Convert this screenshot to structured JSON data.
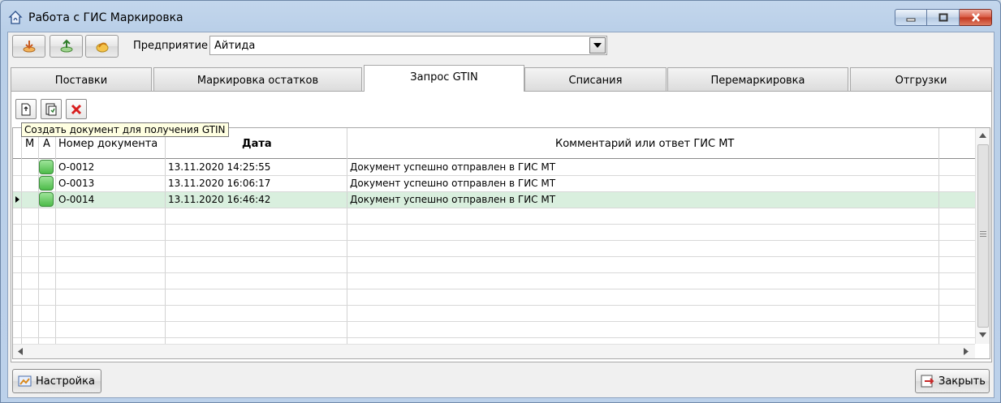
{
  "window": {
    "title": "Работа с ГИС Маркировка"
  },
  "toolbar": {
    "enterprise_label": "Предприятие",
    "enterprise_value": "Айтида"
  },
  "tabs": [
    {
      "label": "Поставки"
    },
    {
      "label": "Маркировка остатков"
    },
    {
      "label": "Запрос GTIN"
    },
    {
      "label": "Списания"
    },
    {
      "label": "Перемаркировка"
    },
    {
      "label": "Отгрузки"
    }
  ],
  "tooltip": "Создать документ для получения GTIN",
  "grid": {
    "columns": {
      "m": "М",
      "a": "А",
      "number": "Номер документа",
      "date": "Дата",
      "comment": "Комментарий или ответ ГИС МТ"
    },
    "rows": [
      {
        "number": "О-0012",
        "date": "13.11.2020 14:25:55",
        "comment": "Документ успешно отправлен в ГИС МТ"
      },
      {
        "number": "О-0013",
        "date": "13.11.2020 16:06:17",
        "comment": "Документ успешно отправлен в ГИС МТ"
      },
      {
        "number": "О-0014",
        "date": "13.11.2020 16:46:42",
        "comment": "Документ успешно отправлен в ГИС МТ"
      }
    ]
  },
  "footer": {
    "settings_label": "Настройка",
    "close_label": "Закрыть"
  },
  "colors": {
    "selected_row": "#d9efde",
    "status_green": "#4dbb4a"
  }
}
